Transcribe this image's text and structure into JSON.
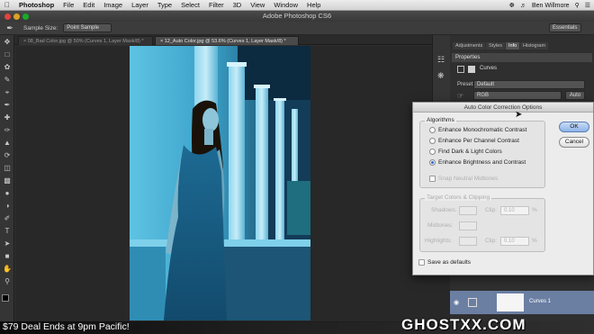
{
  "menubar": {
    "app_name": "Photoshop",
    "items": [
      "File",
      "Edit",
      "Image",
      "Layer",
      "Type",
      "Select",
      "Filter",
      "3D",
      "View",
      "Window",
      "Help"
    ],
    "user": "Ben Willmore"
  },
  "window": {
    "title": "Adobe Photoshop CS6"
  },
  "options": {
    "sample_size_label": "Sample Size:",
    "sample_size_value": "Point Sample",
    "workspace": "Essentials"
  },
  "tabs": [
    {
      "label": "08_Bad Color.jpg @ 50% (Curves 1, Layer Mask/8) *",
      "active": false
    },
    {
      "label": "12_Auto Color.jpg @ 53.6% (Curves 1, Layer Mask/8) *",
      "active": true
    }
  ],
  "panels": {
    "top_tabs": [
      "Adjustments",
      "Styles",
      "Info",
      "Histogram"
    ],
    "active_top_tab": "Info",
    "properties_tab": "Properties",
    "adjustment_name": "Curves",
    "preset_label": "Preset:",
    "preset_value": "Default",
    "channel_value": "RGB",
    "auto_label": "Auto",
    "layer_name": "Curves 1"
  },
  "dialog": {
    "title": "Auto Color Correction Options",
    "algorithms_title": "Algorithms",
    "algorithms": [
      {
        "label": "Enhance Monochromatic Contrast",
        "selected": false
      },
      {
        "label": "Enhance Per Channel Contrast",
        "selected": false
      },
      {
        "label": "Find Dark & Light Colors",
        "selected": false
      },
      {
        "label": "Enhance Brightness and Contrast",
        "selected": true
      }
    ],
    "snap_label": "Snap Neutral Midtones",
    "target_title": "Target Colors & Clipping",
    "shadows_label": "Shadows:",
    "midtones_label": "Midtones:",
    "highlights_label": "Highlights:",
    "clip_label": "Clip:",
    "shadows_clip": "0.10",
    "highlights_clip": "0.10",
    "percent": "%",
    "save_defaults": "Save as defaults",
    "ok": "OK",
    "cancel": "Cancel"
  },
  "banner": {
    "promo": "$79 Deal Ends at 9pm Pacific!",
    "watermark": "GHOSTXX.COM"
  },
  "colors": {
    "photo_dark": "#0d3a52",
    "photo_light": "#4fb7d9",
    "accent_blue": "#2b63c9"
  }
}
